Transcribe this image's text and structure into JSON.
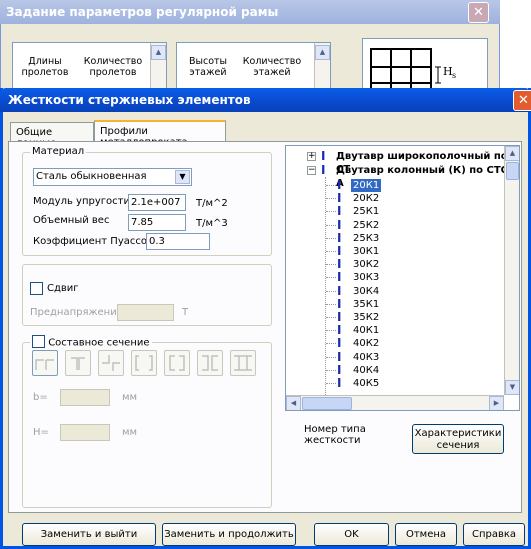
{
  "back_window": {
    "title": "Задание параметров регулярной рамы",
    "close": "✕",
    "col1": "Длины пролетов",
    "col2": "Количество пролетов",
    "col3": "Высоты этажей",
    "col4": "Количество этажей",
    "dim_label": "H",
    "dim_sub": "s"
  },
  "dialog": {
    "title": "Жесткости стержневых элементов",
    "close": "✕",
    "tabs": [
      "Общие данные",
      "Профили металлопроката"
    ],
    "material": {
      "group_label": "Материал",
      "selected": "Сталь обыкновенная",
      "modulus_label": "Модуль упругости",
      "modulus_value": "2.1e+007",
      "modulus_unit": "Т/м^2",
      "weight_label": "Объемный вес",
      "weight_value": "7.85",
      "weight_unit": "Т/м^3",
      "poisson_label": "Коэффициент Пуассона",
      "poisson_value": "0.3"
    },
    "shear": {
      "label": "Сдвиг",
      "prestress_label": "Преднапряжение",
      "prestress_unit": "Т"
    },
    "composite": {
      "label": "Составное сечение",
      "b_label": "b=",
      "b_unit": "мм",
      "h_label": "H=",
      "h_unit": "мм"
    },
    "tree": {
      "root1": "Двутавр широкополочный по СТ",
      "root2": "Двутавр колонный (К) по СТО А",
      "items": [
        "20К1",
        "20К2",
        "25К1",
        "25К2",
        "25К3",
        "30К1",
        "30К2",
        "30К3",
        "30К4",
        "35К1",
        "35К2",
        "40К1",
        "40К2",
        "40К3",
        "40К4",
        "40К5"
      ],
      "selected_index": 0
    },
    "stiffness_type_label": "Номер типа жесткости",
    "section_props_button": "Характеристики сечения",
    "buttons": {
      "replace_exit": "Заменить и выйти",
      "replace_continue": "Заменить и продолжить",
      "ok": "OK",
      "cancel": "Отмена",
      "help": "Справка"
    }
  }
}
